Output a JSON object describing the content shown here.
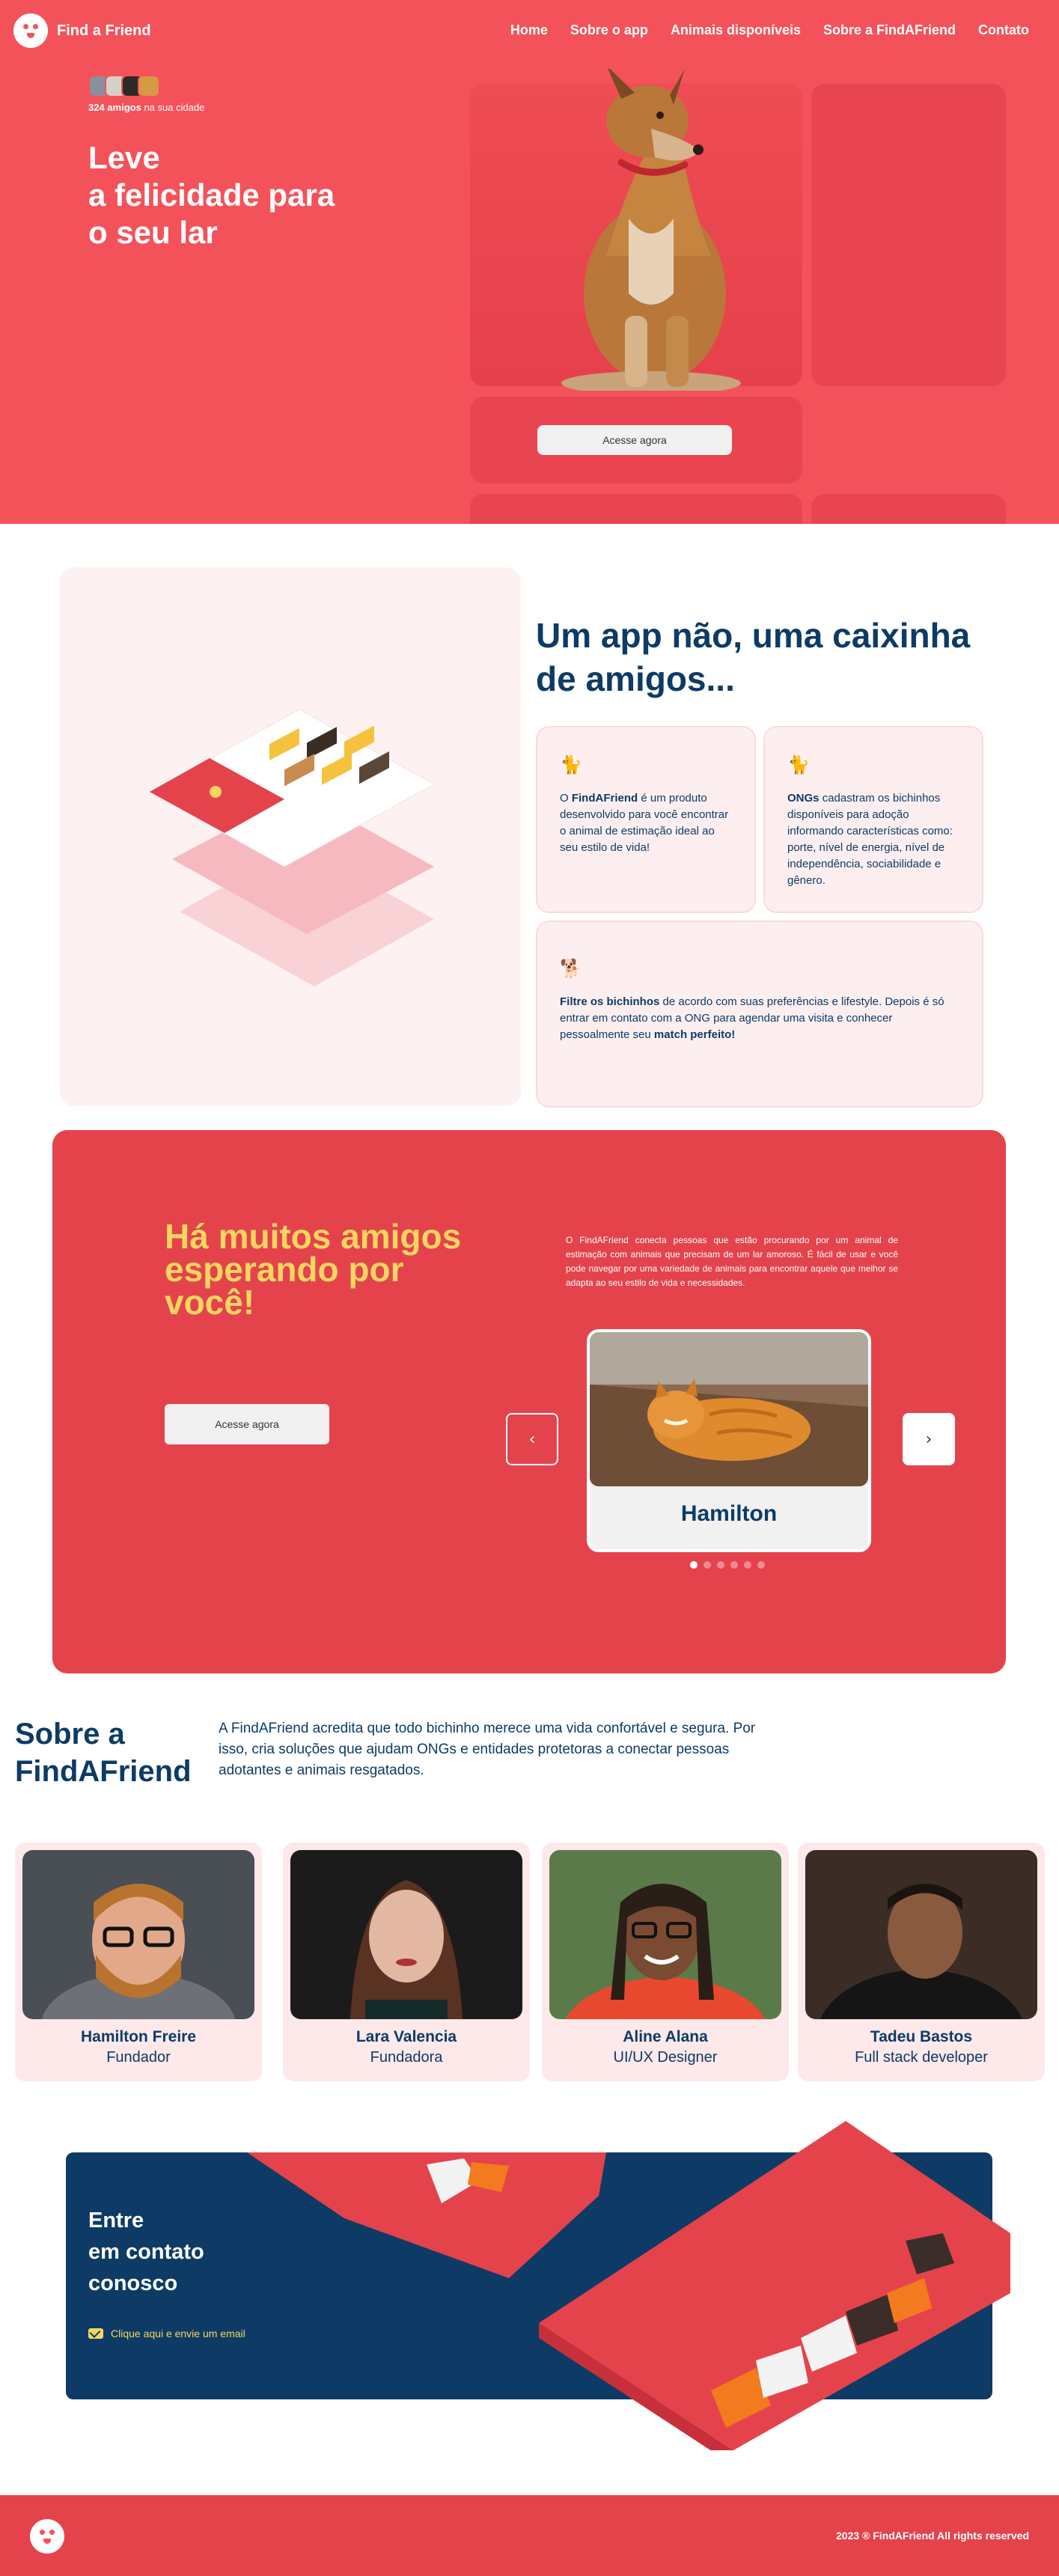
{
  "header": {
    "brand": "Find a Friend",
    "nav": [
      "Home",
      "Sobre o app",
      "Animais disponíveis",
      "Sobre a FindAFriend",
      "Contato"
    ]
  },
  "hero": {
    "friends_count_bold": "324 amigos",
    "friends_count_rest": " na sua cidade",
    "title": "Leve\na felicidade para\no seu lar",
    "cta": "Acesse agora"
  },
  "app_section": {
    "title": "Um app não, uma caixinha\nde amigos...",
    "card1": {
      "bold": "FindAFriend",
      "before": "O ",
      "after": " é um produto desenvolvido para você encontrar o animal de estimação ideal ao seu estilo de vida!"
    },
    "card2": {
      "bold": "ONGs",
      "after": " cadastram os bichinhos disponíveis para adoção informando características como: porte, nível de energia, nível de independência, sociabilidade e gênero."
    },
    "card3": {
      "bold1": "Filtre os bichinhos",
      "middle": " de acordo com suas preferências e lifestyle. Depois é só entrar em contato com a ONG para agendar uma visita e conhecer pessoalmente seu ",
      "bold2": "match perfeito!"
    }
  },
  "friends_section": {
    "title": "Há muitos amigos\nesperando por\nvocê!",
    "text": "O FindAFriend conecta pessoas que estão procurando por um animal de estimação com animais que precisam de um lar amoroso. É fácil de usar e você pode navegar por uma variedade de animais para encontrar aquele que melhor se adapta ao seu estilo de vida e necessidades.",
    "cta": "Acesse agora",
    "pet_name": "Hamilton",
    "slides": 6,
    "active_slide": 1
  },
  "about": {
    "title": "Sobre a\nFindAFriend",
    "text": "A FindAFriend acredita que todo bichinho merece uma vida confortável e segura. Por isso, cria soluções que ajudam ONGs e entidades protetoras a conectar pessoas adotantes e animais resgatados.",
    "team": [
      {
        "name": "Hamilton Freire",
        "role": "Fundador"
      },
      {
        "name": "Lara Valencia",
        "role": "Fundadora"
      },
      {
        "name": "Aline Alana",
        "role": "UI/UX Designer"
      },
      {
        "name": "Tadeu Bastos",
        "role": "Full stack developer"
      }
    ]
  },
  "contact": {
    "title": "Entre\nem contato\nconosco",
    "link": "Clique aqui e envie um email"
  },
  "footer": {
    "copyright": "2023 ® FindAFriend All rights reserved"
  },
  "colors": {
    "primary": "#f4525a",
    "secondary": "#e4434c",
    "navy": "#0d3b66",
    "yellow": "#f6d560"
  }
}
